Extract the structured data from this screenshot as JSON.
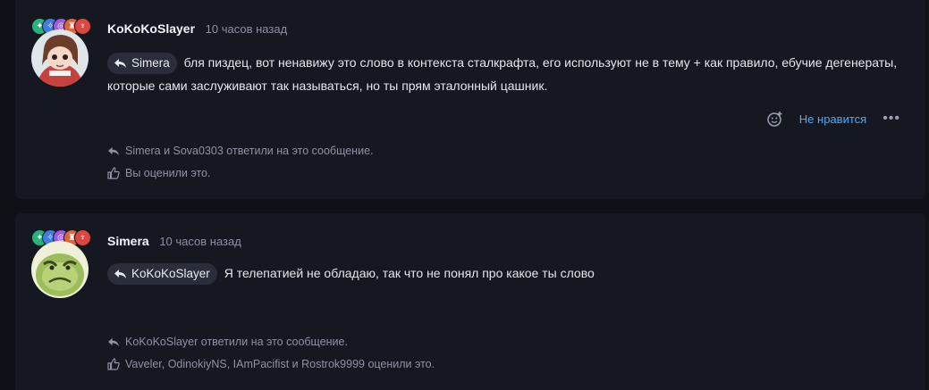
{
  "posts": [
    {
      "author": "KoKoKoSlayer",
      "time": "10 часов назад",
      "reply_to": "Simera",
      "text": "бля пиздец, вот ненавижу это слово в контекста сталкрафта, его используют не в тему + как правило, ебучие дегенераты, которые сами заслуживают так называться, но ты прям эталонный цашник.",
      "actions": {
        "react_icon": "add-reaction-icon",
        "dislike_label": "Не нравится",
        "more_label": "•••"
      },
      "replies_text": "Simera и Sova0303 ответили на это сообщение.",
      "likes_text": "Вы оценили это."
    },
    {
      "author": "Simera",
      "time": "10 часов назад",
      "reply_to": "KoKoKoSlayer",
      "text": "Я телепатией не обладаю, так что не понял про какое ты слово",
      "replies_text": "KoKoKoSlayer ответили на это сообщение.",
      "likes_text": "Vaveler, OdinokiyNS, IAmPacifist и Rostrok9999 оценили это."
    }
  ],
  "badge_colors": [
    "#27b37a",
    "#3f7de0",
    "#9b5ce0",
    "#e0643a",
    "#d9473e"
  ],
  "colors": {
    "accent": "#4ea8ff",
    "background": "#0f1116",
    "card": "#161821"
  }
}
